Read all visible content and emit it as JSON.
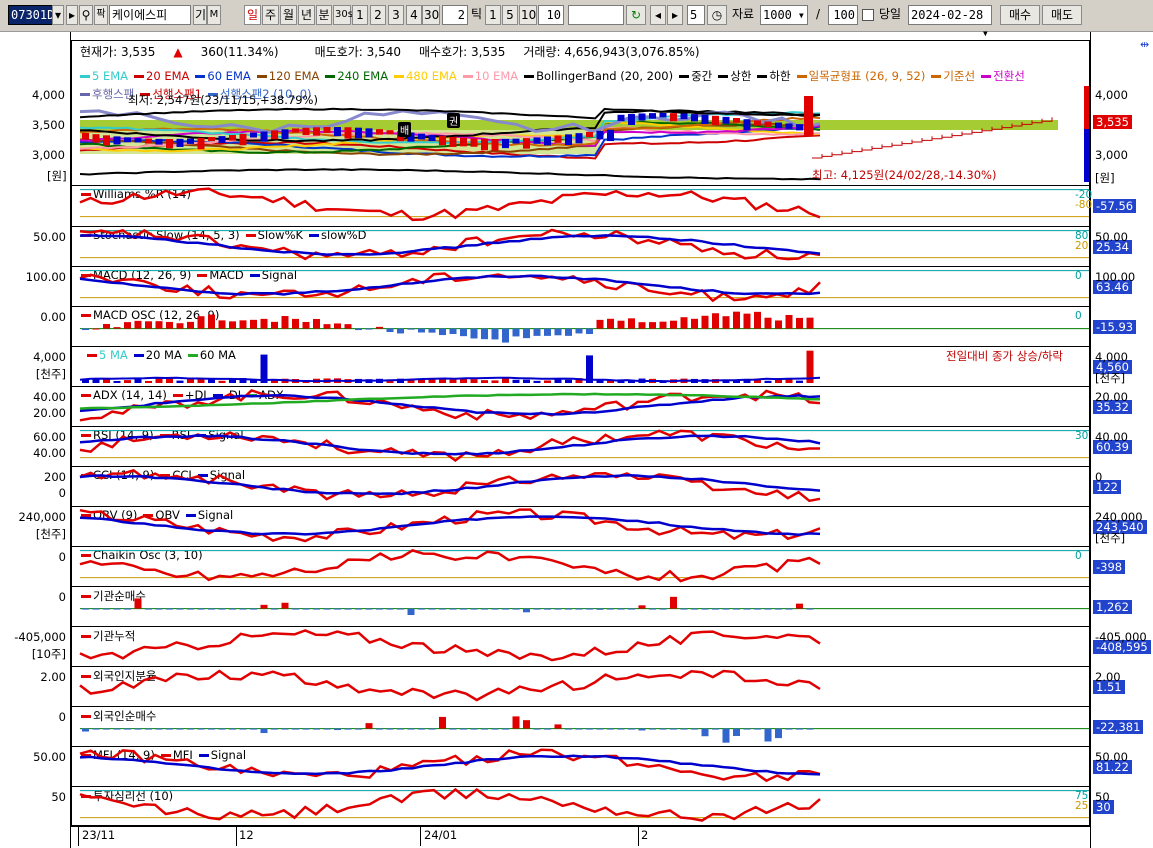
{
  "toolbar": {
    "code": "07301D",
    "search_icon": "search-icon",
    "chart_btn": "팍",
    "stock_name": "케이에스피",
    "gi": "기",
    "m": "M",
    "period_tabs": [
      "일",
      "주",
      "월",
      "년",
      "분",
      "30s",
      "1",
      "2",
      "3",
      "4",
      "30"
    ],
    "count_value": "2",
    "tick_label": "틱",
    "tick_opts": [
      "1",
      "5",
      "10",
      "10"
    ],
    "refresh_icon": "refresh-icon",
    "nav_prev_icon": "triangle-left-icon",
    "nav_next_icon": "triangle-right-icon",
    "step_value": "5",
    "clock_icon": "clock-icon",
    "data_label": "자료",
    "data_count": "1000",
    "slash": "/",
    "total": "100",
    "same_day_label": "당일",
    "date": "2024-02-28",
    "buy_label": "매수",
    "sell_label": "매도"
  },
  "summary": {
    "price": "현재가: 3,535",
    "change": "360(11.34%)",
    "ask": "매도호가: 3,540",
    "bid": "매수호가: 3,535",
    "volume": "거래량: 4,656,943(3,076.85%)"
  },
  "colors": {
    "red": "#e00000",
    "blue": "#0000cc",
    "green": "#008000",
    "black": "#000000",
    "gray": "#8888cc",
    "orange": "#ff8000",
    "magenta": "#ff00ff",
    "lime": "#8fd000",
    "cyan": "#00a0a0"
  },
  "price_legend": [
    {
      "label": "5 EMA",
      "color": "#33cccc"
    },
    {
      "label": "20 EMA",
      "color": "#cc0000"
    },
    {
      "label": "60 EMA",
      "color": "#0033cc"
    },
    {
      "label": "120 EMA",
      "color": "#884400"
    },
    {
      "label": "240 EMA",
      "color": "#006600"
    },
    {
      "label": "480 EMA",
      "color": "#ffcc00"
    },
    {
      "label": "10 EMA",
      "color": "#ff99aa"
    },
    {
      "label": "BollingerBand (20, 200)",
      "color": "#000000"
    },
    {
      "label": "중간",
      "color": "#000000"
    },
    {
      "label": "상한",
      "color": "#000000"
    },
    {
      "label": "하한",
      "color": "#000000"
    },
    {
      "label": "일목균형표 (26, 9, 52)",
      "color": "#cc6600"
    },
    {
      "label": "기준선",
      "color": "#cc6600"
    },
    {
      "label": "전환선",
      "color": "#cc00cc"
    }
  ],
  "price_legend2": [
    {
      "label": "후행스팬",
      "color": "#6666aa"
    },
    {
      "label": "선행스팬1",
      "color": "#cc0000"
    },
    {
      "label": "선행스팬2 (10, 0)",
      "color": "#3366cc"
    }
  ],
  "price_annotations": {
    "low": "최저: 2,547원(23/11/15,+38.79%)",
    "high": "최고: 4,125원(24/02/28,-14.30%)",
    "badge_bae": "배",
    "badge_gwon": "권"
  },
  "price_axis": {
    "left": [
      "4,000",
      "3,500",
      "3,000",
      "[원]"
    ],
    "right": [
      "4,000",
      "3,000",
      "[원]"
    ],
    "current": "3,535"
  },
  "panels": [
    {
      "id": "williams",
      "title": "Williams %R (14)",
      "right_value": "-57.56",
      "levels": [
        "-20",
        "-80"
      ],
      "left_ticks": [],
      "value_color": "#2244cc"
    },
    {
      "id": "stoch",
      "title": "Stochastic Slow (14, 5, 3)",
      "legend": [
        "Slow%K",
        "slow%D"
      ],
      "right_value": "25.34",
      "levels": [
        "80",
        "20"
      ],
      "left_ticks": [
        "50.00"
      ],
      "right_ticks": [
        "50.00"
      ],
      "value_color": "#2244cc"
    },
    {
      "id": "macd",
      "title": "MACD (12, 26, 9)",
      "legend": [
        "MACD",
        "Signal"
      ],
      "right_value": "63.46",
      "levels": [
        "0"
      ],
      "left_ticks": [
        "100.00"
      ],
      "right_ticks": [
        "100.00"
      ],
      "value_color": "#2244cc"
    },
    {
      "id": "macdosc",
      "title": "MACD OSC (12, 26, 9)",
      "right_value": "-15.93",
      "levels": [
        "0"
      ],
      "left_ticks": [
        "0.00"
      ],
      "value_color": "#2244cc"
    },
    {
      "id": "volume",
      "title": "",
      "legend": [
        "5 MA",
        "20 MA",
        "60 MA"
      ],
      "right_value": "4,560",
      "right_ticks": [
        "4,000",
        "[천주]"
      ],
      "left_ticks": [
        "4,000",
        "[천주]"
      ],
      "note": "전일대비 종가 상승/하락",
      "value_color": "#2244cc"
    },
    {
      "id": "adx",
      "title": "ADX (14, 14)",
      "legend": [
        "+DI",
        "-DI",
        "ADX"
      ],
      "right_value": "35.32",
      "left_ticks": [
        "40.00",
        "20.00"
      ],
      "right_ticks": [
        "20.00"
      ],
      "value_color": "#2244cc"
    },
    {
      "id": "rsi",
      "title": "RSI (14, 9)",
      "legend": [
        "RSI",
        "Signal"
      ],
      "right_value": "60.39",
      "levels": [
        "30"
      ],
      "left_ticks": [
        "60.00",
        "40.00"
      ],
      "right_ticks": [
        "40.00"
      ],
      "value_color": "#2244cc"
    },
    {
      "id": "cci",
      "title": "CCI (14, 9)",
      "legend": [
        "CCI",
        "Signal"
      ],
      "right_value": "122",
      "left_ticks": [
        "200",
        "0"
      ],
      "right_ticks": [
        "0"
      ],
      "value_color": "#2244cc"
    },
    {
      "id": "obv",
      "title": "OBV (9)",
      "legend": [
        "OBV",
        "Signal"
      ],
      "right_value": "243,540",
      "left_ticks": [
        "240,000",
        "[천주]"
      ],
      "right_ticks": [
        "240,000",
        "[천주]"
      ],
      "value_color": "#2244cc"
    },
    {
      "id": "chaikin",
      "title": "Chaikin Osc (3, 10)",
      "right_value": "-398",
      "levels": [
        "0"
      ],
      "left_ticks": [
        "0"
      ],
      "value_color": "#2244cc"
    },
    {
      "id": "inst",
      "title": "기관순매수",
      "right_value": "1,262",
      "left_ticks": [
        "0"
      ],
      "value_color": "#2244cc"
    },
    {
      "id": "instcum",
      "title": "기관누적",
      "right_value": "-408,595",
      "left_ticks": [
        "-405,000",
        "[10주]"
      ],
      "right_ticks": [
        "-405,000"
      ],
      "value_color": "#2244cc"
    },
    {
      "id": "foreign",
      "title": "외국인지분율",
      "right_value": "1.51",
      "left_ticks": [
        "2.00"
      ],
      "right_ticks": [
        "2.00"
      ],
      "value_color": "#2244cc"
    },
    {
      "id": "foreignnet",
      "title": "외국인순매수",
      "right_value": "-22,381",
      "left_ticks": [
        "0"
      ],
      "value_color": "#2244cc"
    },
    {
      "id": "mfi",
      "title": "MFI (14, 9)",
      "legend": [
        "MFI",
        "Signal"
      ],
      "right_value": "81.22",
      "left_ticks": [
        "50.00"
      ],
      "right_ticks": [
        "50.00"
      ],
      "value_color": "#2244cc"
    },
    {
      "id": "psy",
      "title": "투자심리선 (10)",
      "right_value": "30",
      "levels": [
        "75",
        "25"
      ],
      "left_ticks": [
        "50"
      ],
      "right_ticks": [
        "50"
      ],
      "value_color": "#2244cc"
    }
  ],
  "x_axis": {
    "labels": [
      "23/11",
      "12",
      "24/01",
      "2"
    ]
  }
}
